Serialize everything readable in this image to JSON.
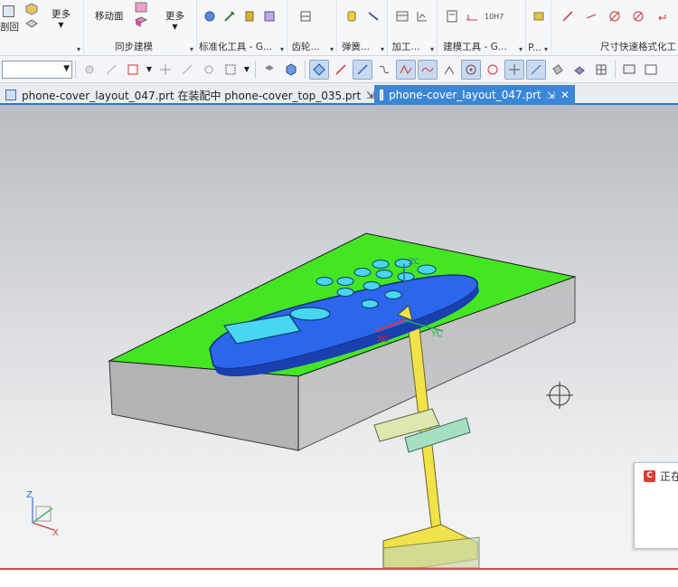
{
  "ribbon": {
    "groups": [
      {
        "label": "",
        "buttons": [
          "剖回",
          "更多"
        ]
      },
      {
        "label": "同步建模",
        "buttons": [
          "移动面",
          "更多"
        ]
      },
      {
        "label": "标准化工具 - G...",
        "buttons": []
      },
      {
        "label": "齿轮...",
        "buttons": []
      },
      {
        "label": "弹簧...",
        "buttons": []
      },
      {
        "label": "加工...",
        "buttons": []
      },
      {
        "label": "建模工具 - G...",
        "buttons": []
      },
      {
        "label": "P...",
        "buttons": []
      },
      {
        "label": "尺寸快速格式化工",
        "buttons": []
      }
    ],
    "small_text": "10H7"
  },
  "tabs": [
    {
      "label": "phone-cover_layout_047.prt 在装配中 phone-cover_top_035.prt",
      "active": false
    },
    {
      "label": "phone-cover_layout_047.prt",
      "active": true
    }
  ],
  "axes": {
    "z": "Z",
    "x": "X",
    "y": "Y",
    "xc": "XC",
    "yc": "YC",
    "zc": "ZC"
  },
  "toast": {
    "text": "正在"
  },
  "colors": {
    "accent": "#3b86d6",
    "base_top": "#44e624",
    "shell": "#2b66ec",
    "keys": "#49d6f0",
    "rod": "#f2e24a"
  }
}
